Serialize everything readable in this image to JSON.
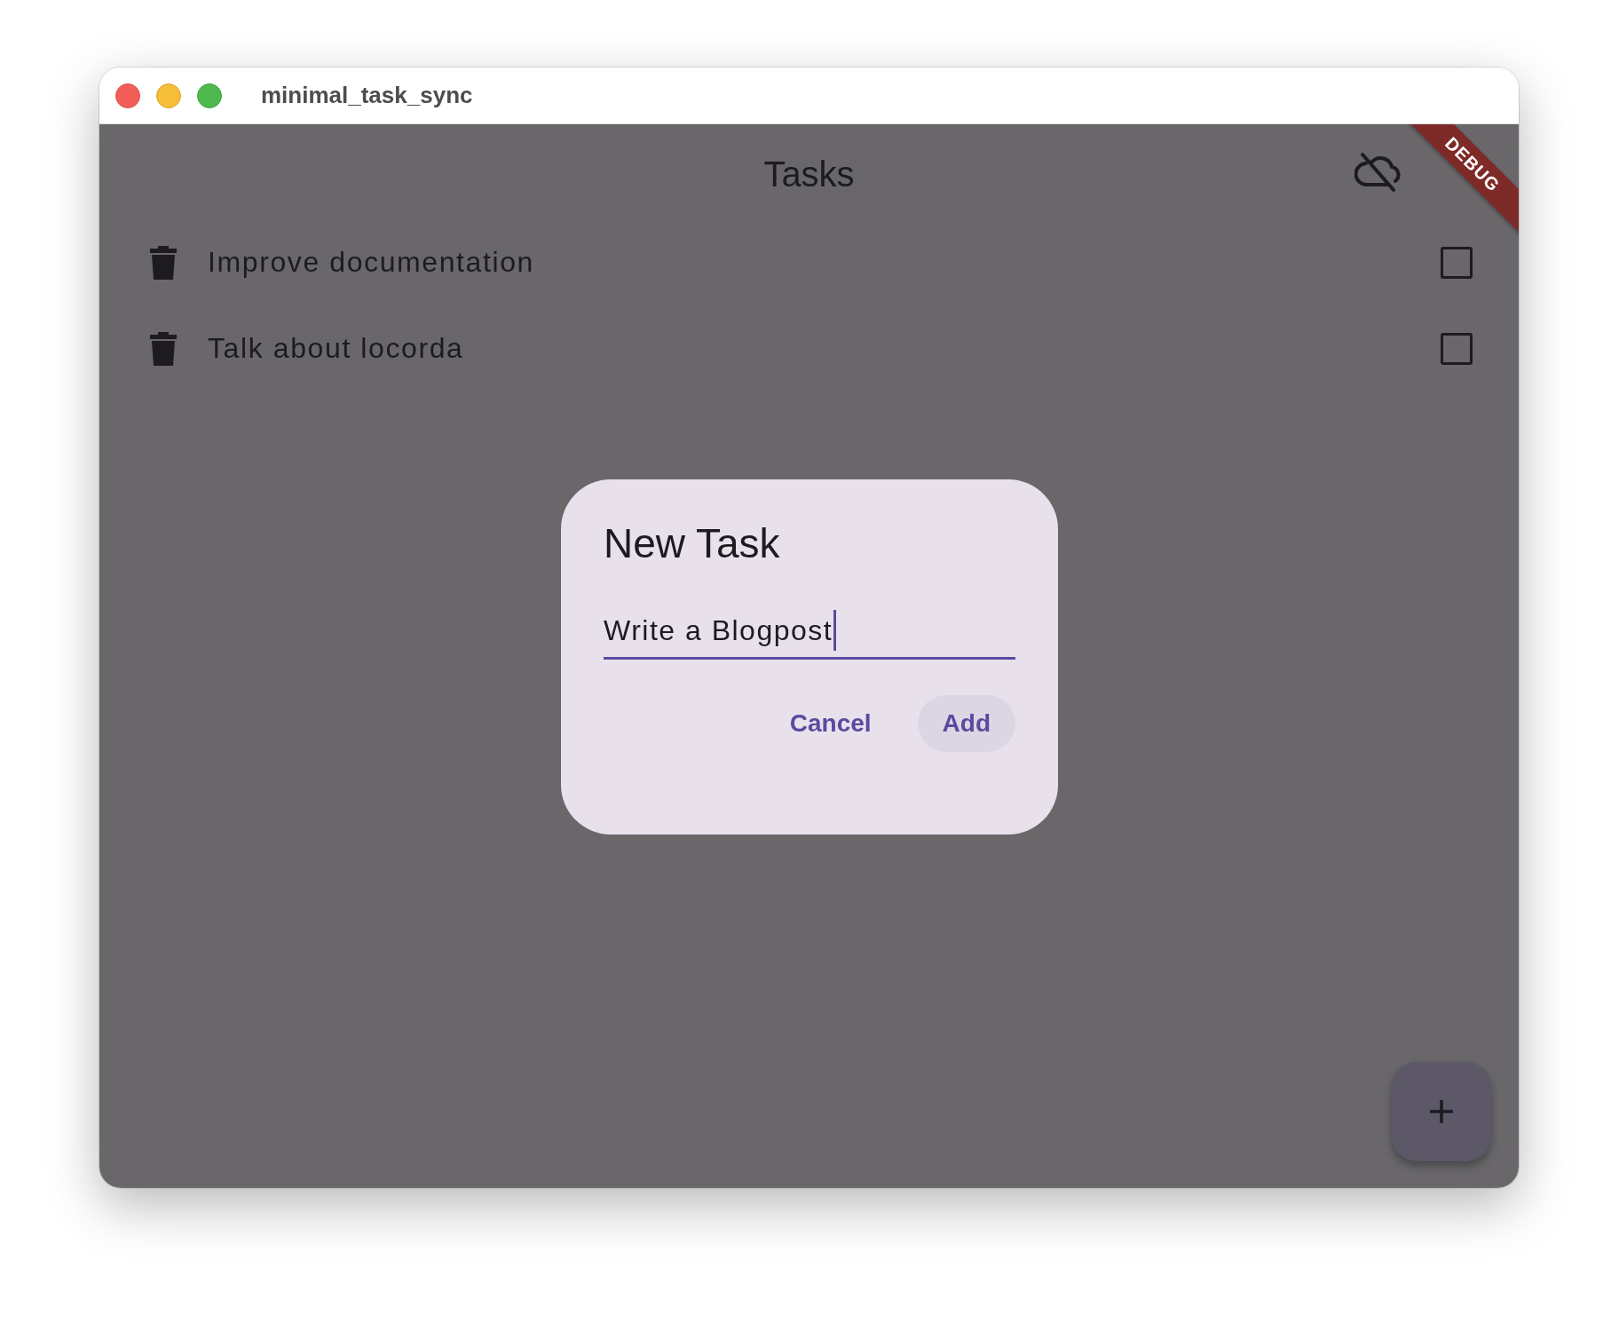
{
  "window": {
    "title": "minimal_task_sync"
  },
  "app_bar": {
    "title": "Tasks"
  },
  "debug_banner": "DEBUG",
  "tasks": [
    {
      "label": "Improve documentation",
      "checked": false
    },
    {
      "label": "Talk about locorda",
      "checked": false
    }
  ],
  "dialog": {
    "title": "New Task",
    "input": {
      "value": "Write a Blogpost"
    },
    "buttons": [
      {
        "label": "Cancel",
        "kind": "text"
      },
      {
        "label": "Add",
        "kind": "tonal"
      }
    ]
  }
}
